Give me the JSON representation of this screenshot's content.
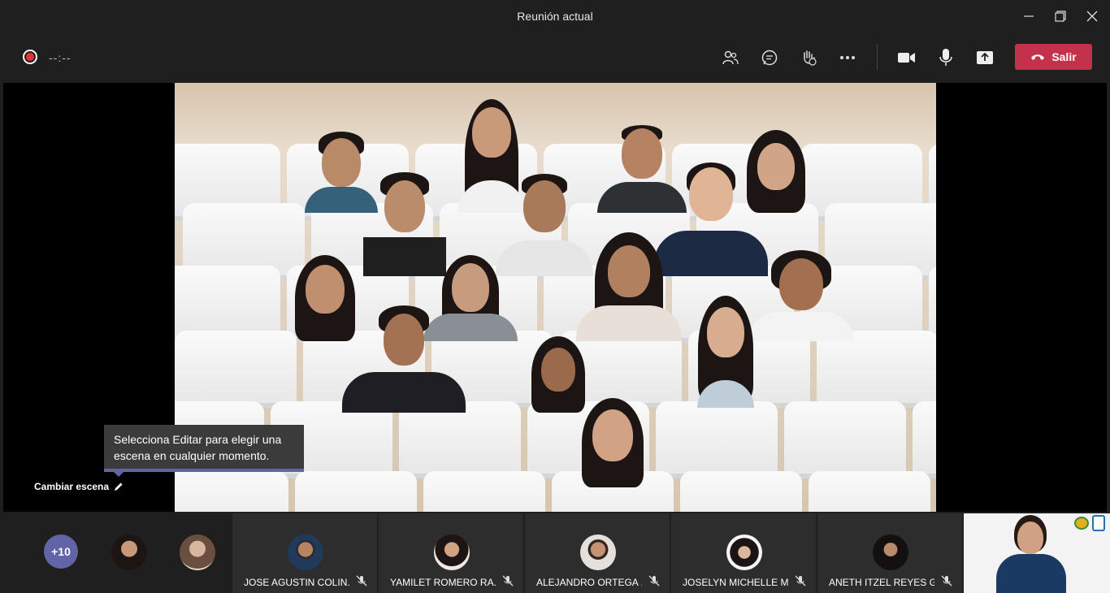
{
  "window": {
    "title": "Reunión actual"
  },
  "toolbar": {
    "timer": "--:--",
    "leave_label": "Salir"
  },
  "scene": {
    "tooltip": "Selecciona Editar para elegir una escena en cualquier momento.",
    "change_scene_label": "Cambiar escena"
  },
  "participants": {
    "more_count": "+10",
    "tiles": [
      {
        "name": "JOSE AGUSTIN COLIN..."
      },
      {
        "name": "YAMILET ROMERO RA..."
      },
      {
        "name": "ALEJANDRO ORTEGA ..."
      },
      {
        "name": "JOSELYN MICHELLE M..."
      },
      {
        "name": "ANETH ITZEL REYES G..."
      }
    ]
  },
  "colors": {
    "accent": "#6264a7",
    "leave": "#c4314b",
    "record": "#e8313b"
  }
}
